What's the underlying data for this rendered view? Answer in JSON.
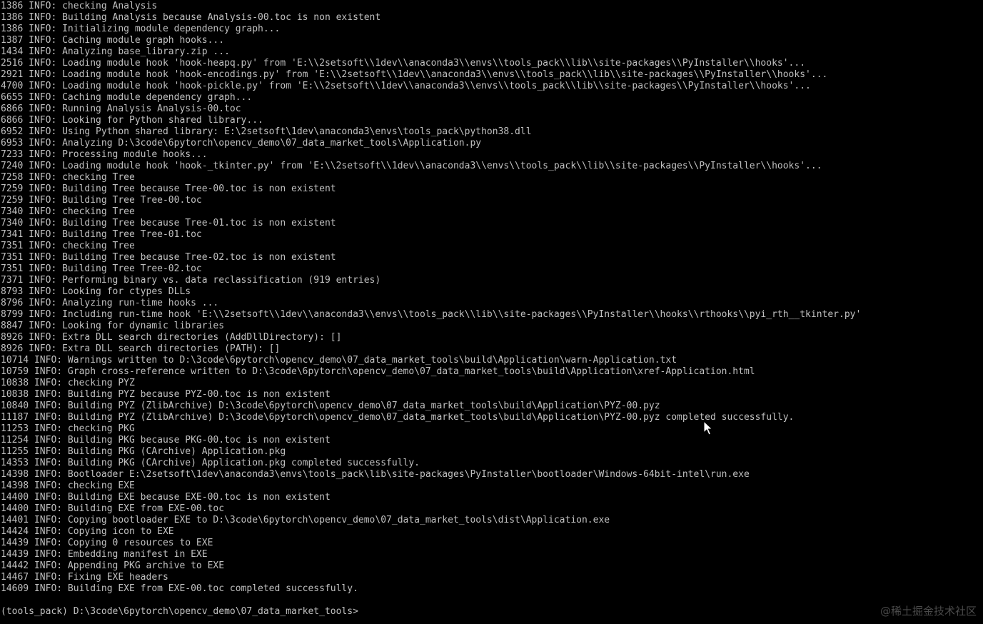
{
  "console": {
    "lines": [
      "1386 INFO: checking Analysis",
      "1386 INFO: Building Analysis because Analysis-00.toc is non existent",
      "1386 INFO: Initializing module dependency graph...",
      "1387 INFO: Caching module graph hooks...",
      "1434 INFO: Analyzing base_library.zip ...",
      "2516 INFO: Loading module hook 'hook-heapq.py' from 'E:\\\\2setsoft\\\\1dev\\\\anaconda3\\\\envs\\\\tools_pack\\\\lib\\\\site-packages\\\\PyInstaller\\\\hooks'...",
      "2921 INFO: Loading module hook 'hook-encodings.py' from 'E:\\\\2setsoft\\\\1dev\\\\anaconda3\\\\envs\\\\tools_pack\\\\lib\\\\site-packages\\\\PyInstaller\\\\hooks'...",
      "4700 INFO: Loading module hook 'hook-pickle.py' from 'E:\\\\2setsoft\\\\1dev\\\\anaconda3\\\\envs\\\\tools_pack\\\\lib\\\\site-packages\\\\PyInstaller\\\\hooks'...",
      "6655 INFO: Caching module dependency graph...",
      "6866 INFO: Running Analysis Analysis-00.toc",
      "6866 INFO: Looking for Python shared library...",
      "6952 INFO: Using Python shared library: E:\\2setsoft\\1dev\\anaconda3\\envs\\tools_pack\\python38.dll",
      "6953 INFO: Analyzing D:\\3code\\6pytorch\\opencv_demo\\07_data_market_tools\\Application.py",
      "7233 INFO: Processing module hooks...",
      "7240 INFO: Loading module hook 'hook-_tkinter.py' from 'E:\\\\2setsoft\\\\1dev\\\\anaconda3\\\\envs\\\\tools_pack\\\\lib\\\\site-packages\\\\PyInstaller\\\\hooks'...",
      "7258 INFO: checking Tree",
      "7259 INFO: Building Tree because Tree-00.toc is non existent",
      "7259 INFO: Building Tree Tree-00.toc",
      "7340 INFO: checking Tree",
      "7340 INFO: Building Tree because Tree-01.toc is non existent",
      "7341 INFO: Building Tree Tree-01.toc",
      "7351 INFO: checking Tree",
      "7351 INFO: Building Tree because Tree-02.toc is non existent",
      "7351 INFO: Building Tree Tree-02.toc",
      "7371 INFO: Performing binary vs. data reclassification (919 entries)",
      "8793 INFO: Looking for ctypes DLLs",
      "8796 INFO: Analyzing run-time hooks ...",
      "8799 INFO: Including run-time hook 'E:\\\\2setsoft\\\\1dev\\\\anaconda3\\\\envs\\\\tools_pack\\\\lib\\\\site-packages\\\\PyInstaller\\\\hooks\\\\rthooks\\\\pyi_rth__tkinter.py'",
      "8847 INFO: Looking for dynamic libraries",
      "8926 INFO: Extra DLL search directories (AddDllDirectory): []",
      "8926 INFO: Extra DLL search directories (PATH): []",
      "10714 INFO: Warnings written to D:\\3code\\6pytorch\\opencv_demo\\07_data_market_tools\\build\\Application\\warn-Application.txt",
      "10759 INFO: Graph cross-reference written to D:\\3code\\6pytorch\\opencv_demo\\07_data_market_tools\\build\\Application\\xref-Application.html",
      "10838 INFO: checking PYZ",
      "10838 INFO: Building PYZ because PYZ-00.toc is non existent",
      "10840 INFO: Building PYZ (ZlibArchive) D:\\3code\\6pytorch\\opencv_demo\\07_data_market_tools\\build\\Application\\PYZ-00.pyz",
      "11187 INFO: Building PYZ (ZlibArchive) D:\\3code\\6pytorch\\opencv_demo\\07_data_market_tools\\build\\Application\\PYZ-00.pyz completed successfully.",
      "11253 INFO: checking PKG",
      "11254 INFO: Building PKG because PKG-00.toc is non existent",
      "11255 INFO: Building PKG (CArchive) Application.pkg",
      "14353 INFO: Building PKG (CArchive) Application.pkg completed successfully.",
      "14398 INFO: Bootloader E:\\2setsoft\\1dev\\anaconda3\\envs\\tools_pack\\lib\\site-packages\\PyInstaller\\bootloader\\Windows-64bit-intel\\run.exe",
      "14398 INFO: checking EXE",
      "14400 INFO: Building EXE because EXE-00.toc is non existent",
      "14400 INFO: Building EXE from EXE-00.toc",
      "14401 INFO: Copying bootloader EXE to D:\\3code\\6pytorch\\opencv_demo\\07_data_market_tools\\dist\\Application.exe",
      "14424 INFO: Copying icon to EXE",
      "14439 INFO: Copying 0 resources to EXE",
      "14439 INFO: Embedding manifest in EXE",
      "14442 INFO: Appending PKG archive to EXE",
      "14467 INFO: Fixing EXE headers",
      "14609 INFO: Building EXE from EXE-00.toc completed successfully."
    ],
    "prompt": "(tools_pack) D:\\3code\\6pytorch\\opencv_demo\\07_data_market_tools>",
    "background_color": "#000000",
    "text_color": "#c0c0c0"
  },
  "watermark": {
    "text": "@稀土掘金技术社区"
  },
  "cursor": {
    "icon": "mouse-pointer-icon"
  }
}
